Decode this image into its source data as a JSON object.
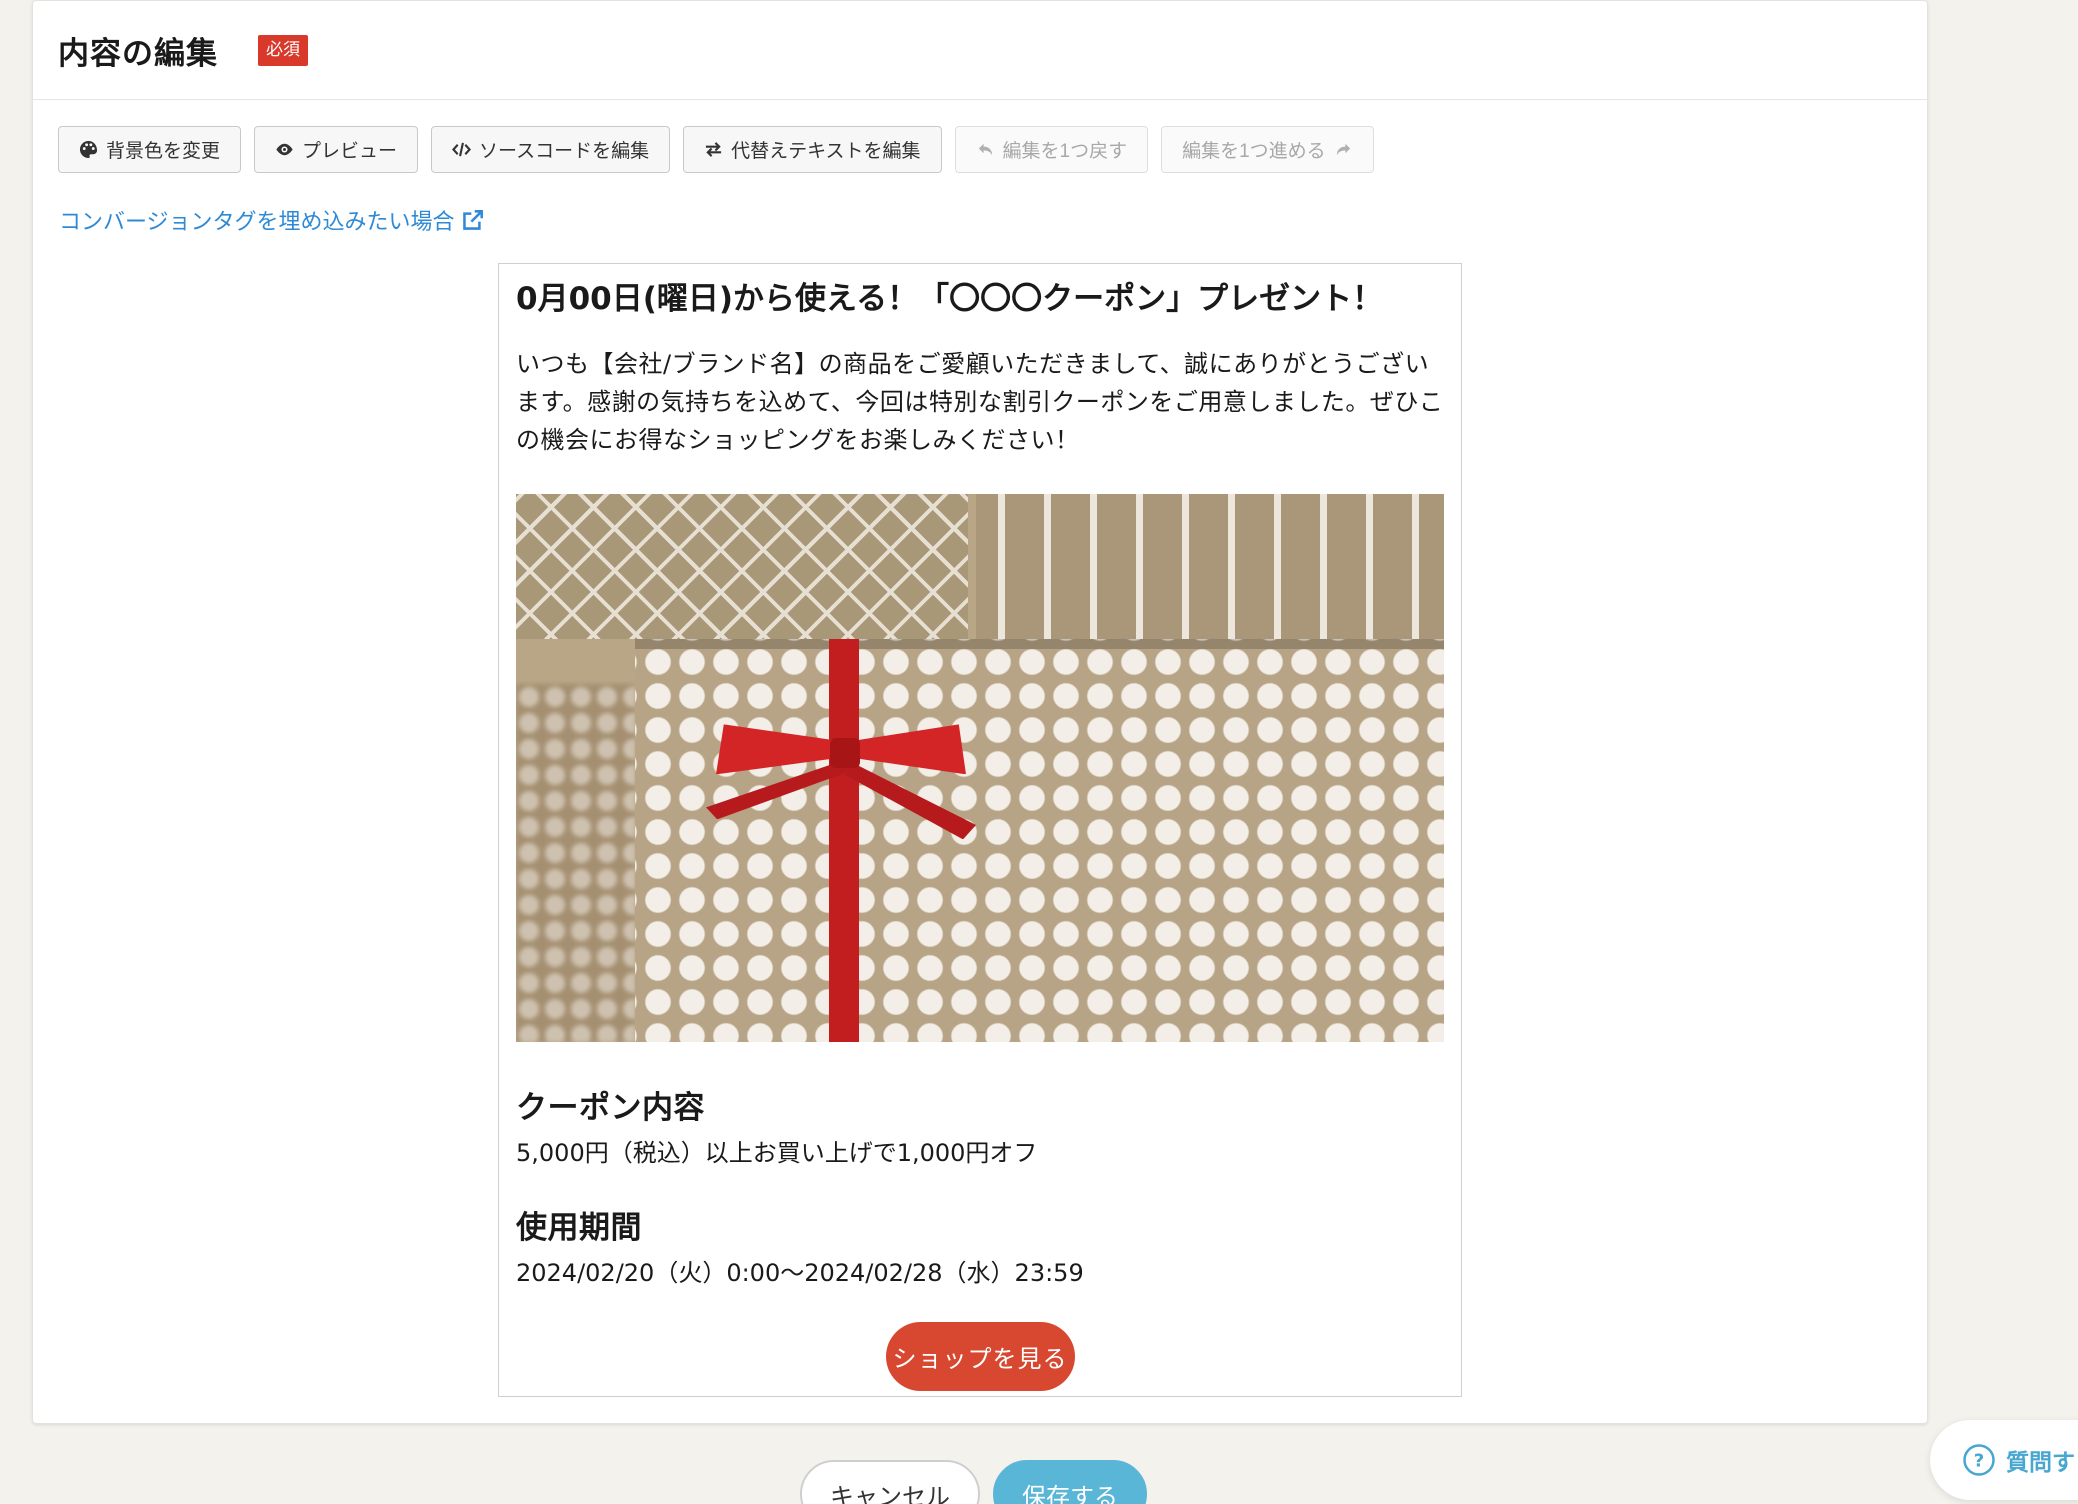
{
  "header": {
    "title": "内容の編集",
    "required_badge": "必須"
  },
  "toolbar": {
    "bg_color": "背景色を変更",
    "preview": "プレビュー",
    "source": "ソースコードを編集",
    "alt_text": "代替えテキストを編集",
    "undo": "編集を1つ戻す",
    "redo": "編集を1つ進める"
  },
  "conversion_link": "コンバージョンタグを埋め込みたい場合",
  "preview": {
    "title": "0月00日(曜日)から使える！「〇〇〇クーポン」プレゼント！",
    "body": "いつも【会社/ブランド名】の商品をご愛顧いただきまして、誠にありがとうございます。感謝の気持ちを込めて、今回は特別な割引クーポンをご用意しました。ぜひこの機会にお得なショッピングをお楽しみください！",
    "coupon_heading": "クーポン内容",
    "coupon_text": "5,000円（税込）以上お買い上げで1,000円オフ",
    "period_heading": "使用期間",
    "period_text": "2024/02/20（火）0:00〜2024/02/28（水）23:59",
    "shop_button": "ショップを見る"
  },
  "footer": {
    "cancel": "キャンセル",
    "save": "保存する"
  },
  "help": {
    "label": "質問す"
  },
  "colors": {
    "required": "#d8392b",
    "link": "#2f8ad6",
    "shop_button": "#d8472f",
    "save_button": "#5ab6d6"
  }
}
